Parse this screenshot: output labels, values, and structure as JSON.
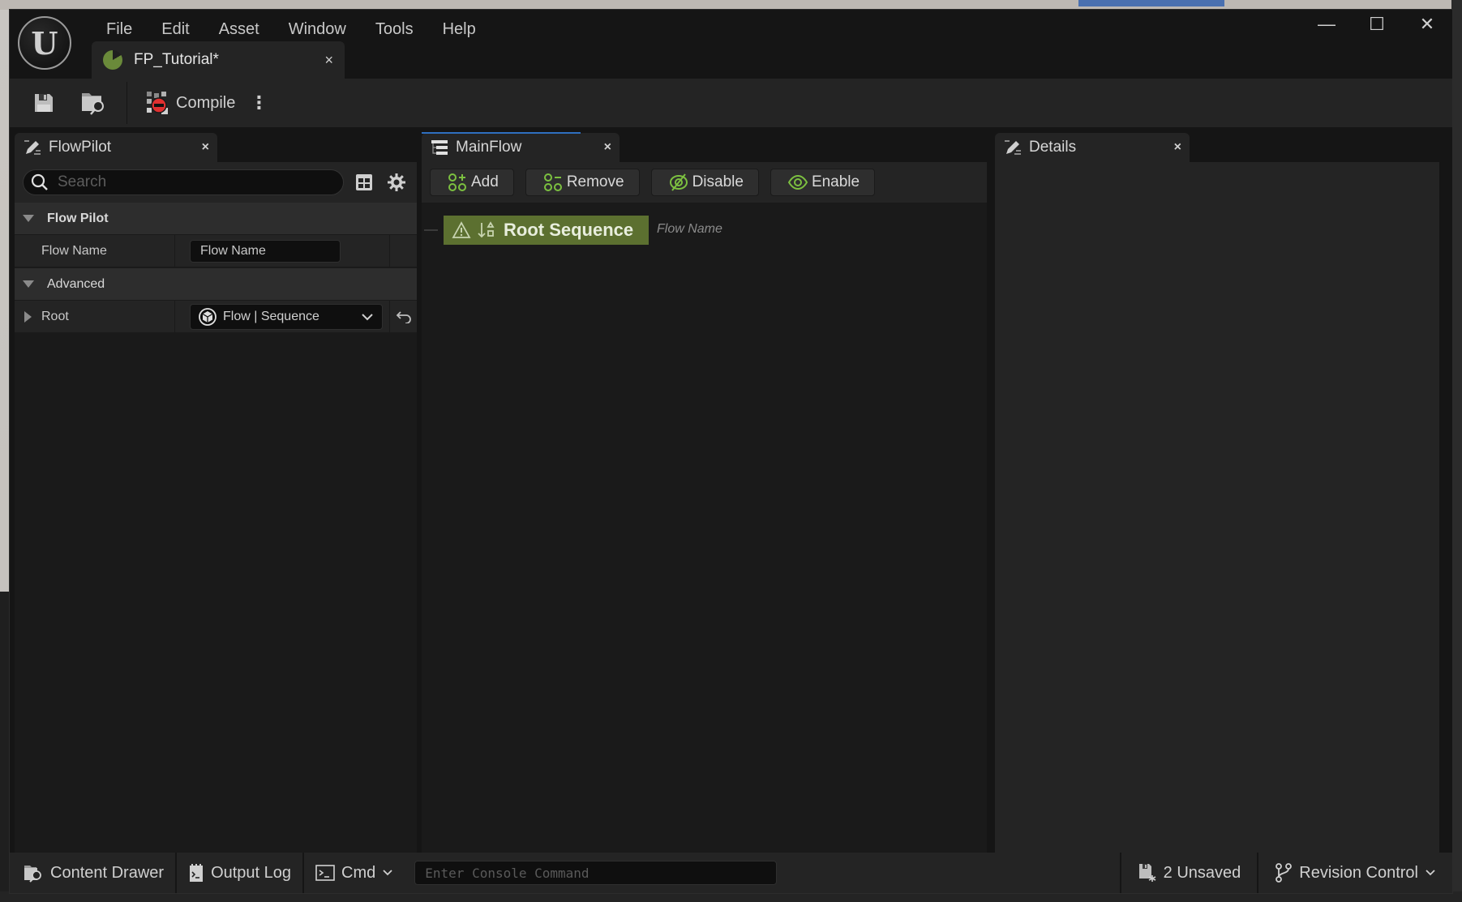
{
  "window": {
    "menu": [
      "File",
      "Edit",
      "Asset",
      "Window",
      "Tools",
      "Help"
    ],
    "controls": {
      "minimize": "—",
      "maximize": "☐",
      "close": "✕"
    },
    "document_tab": {
      "title": "FP_Tutorial*",
      "close": "×"
    }
  },
  "toolbar": {
    "compile_label": "Compile",
    "more_label": "⋮"
  },
  "flowpilot_panel": {
    "tab_label": "FlowPilot",
    "close": "×",
    "search_placeholder": "Search",
    "categories": [
      {
        "label": "Flow Pilot",
        "properties": [
          {
            "name": "Flow Name",
            "value": "Flow Name"
          }
        ]
      },
      {
        "label": "Advanced",
        "properties": [
          {
            "name": "Root",
            "value": "Flow | Sequence"
          }
        ]
      }
    ]
  },
  "mainflow_panel": {
    "tab_label": "MainFlow",
    "close": "×",
    "buttons": {
      "add": "Add",
      "remove": "Remove",
      "disable": "Disable",
      "enable": "Enable"
    },
    "root_node": {
      "label": "Root Sequence",
      "description": "Flow Name"
    },
    "accent_color": "#5c7030"
  },
  "details_panel": {
    "tab_label": "Details",
    "close": "×"
  },
  "statusbar": {
    "content_drawer": "Content Drawer",
    "output_log": "Output Log",
    "cmd": "Cmd",
    "console_placeholder": "Enter Console Command",
    "unsaved": "2 Unsaved",
    "revision_control": "Revision Control"
  }
}
